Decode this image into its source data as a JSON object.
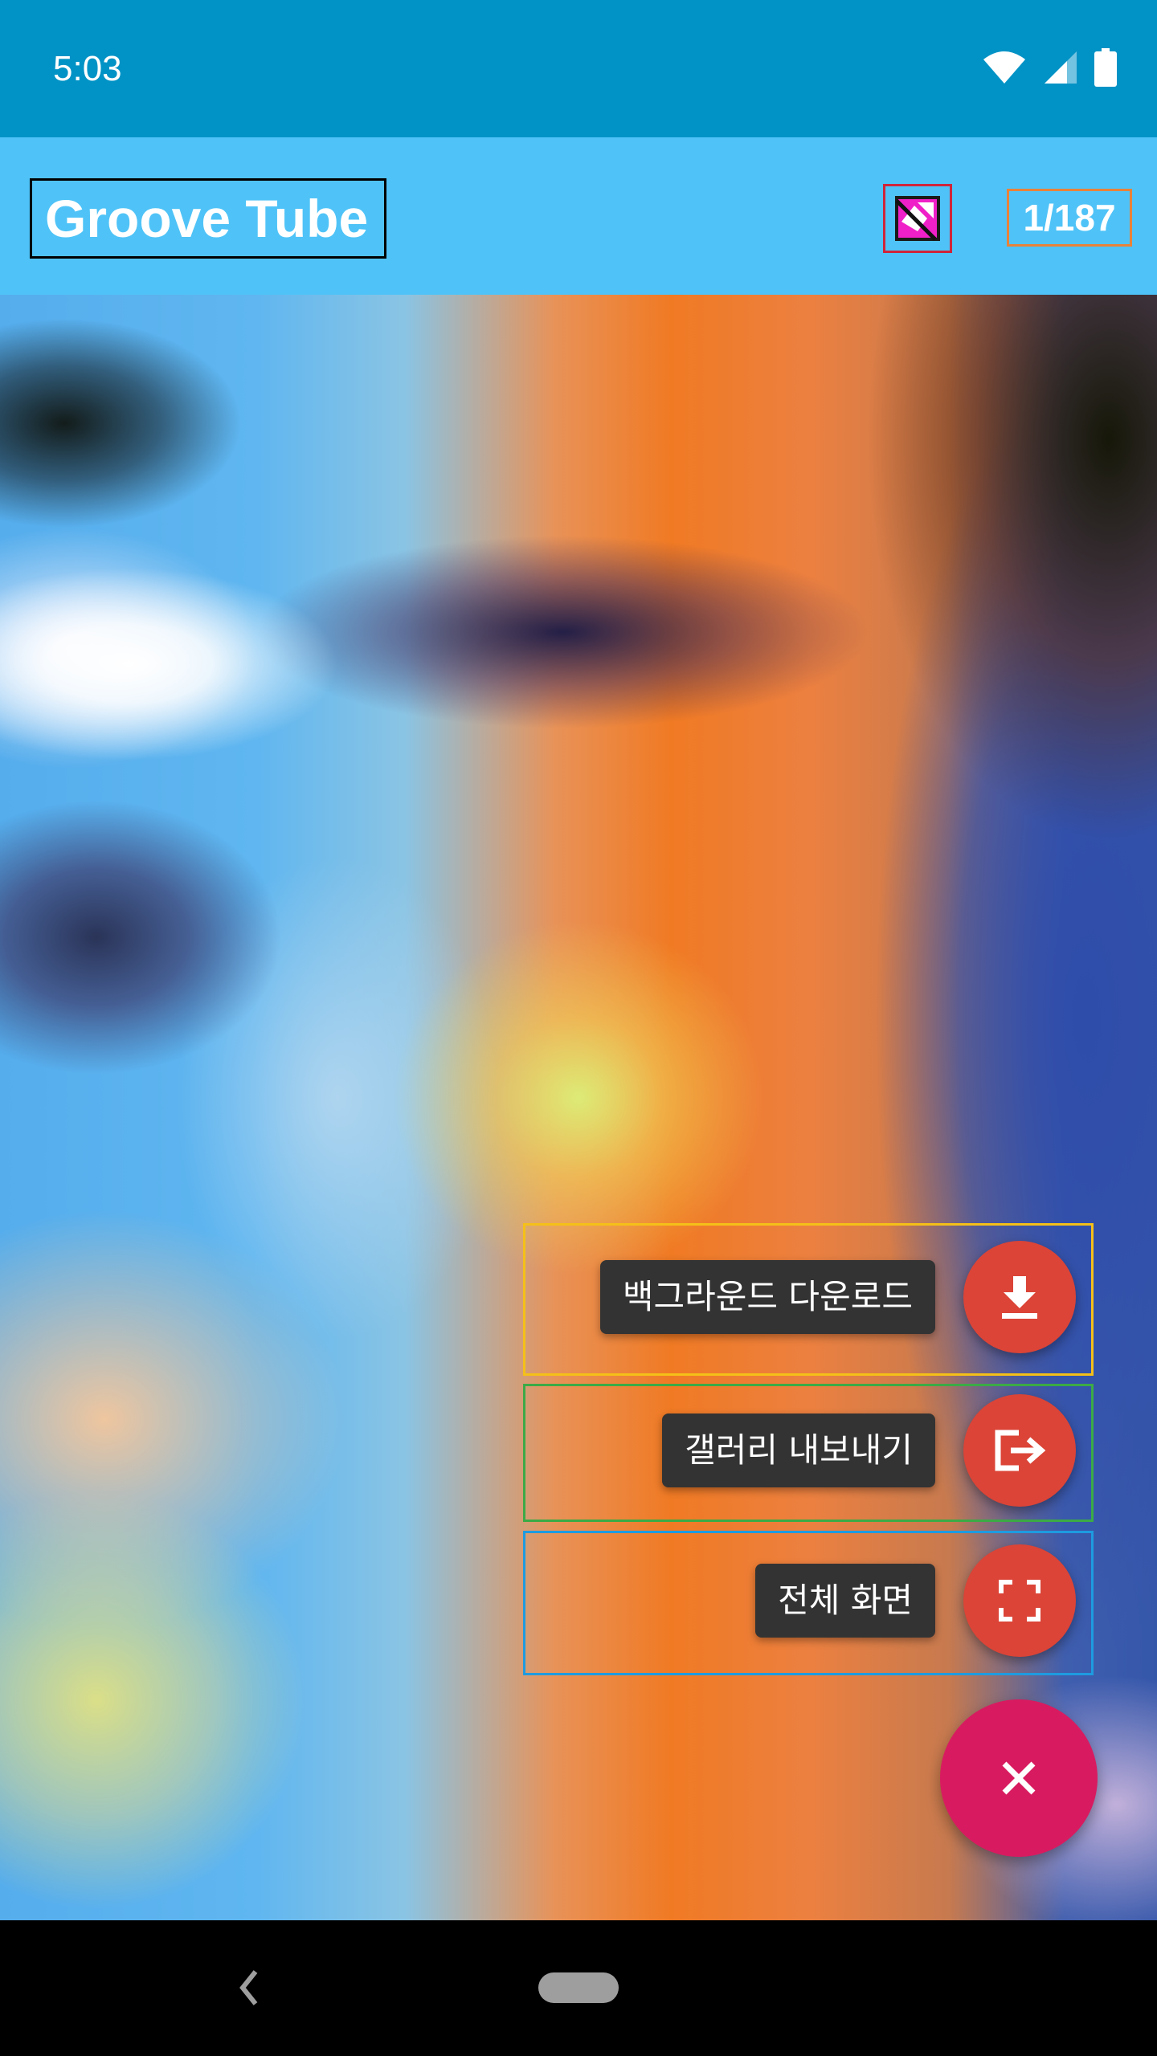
{
  "status_bar": {
    "time": "5:03",
    "icons": [
      "wifi-icon",
      "cell-signal-icon",
      "battery-icon"
    ]
  },
  "app_bar": {
    "title": "Groove Tube",
    "action_icon": "broken-image-icon",
    "page_counter": "1/187"
  },
  "fab_menu": {
    "items": [
      {
        "label": "백그라운드 다운로드",
        "icon": "download-icon",
        "frame_color": "#F5C018"
      },
      {
        "label": "갤러리 내보내기",
        "icon": "export-icon",
        "frame_color": "#3CAA46"
      },
      {
        "label": "전체 화면",
        "icon": "fullscreen-icon",
        "frame_color": "#1E9BE0"
      }
    ],
    "main_icon": "close-icon"
  },
  "nav_bar": {
    "buttons": [
      "back-icon",
      "home-pill"
    ]
  },
  "colors": {
    "status_bar": "#0293C6",
    "app_bar": "#4FC3F7",
    "mini_fab": "#DB4437",
    "main_fab": "#D81B60"
  }
}
